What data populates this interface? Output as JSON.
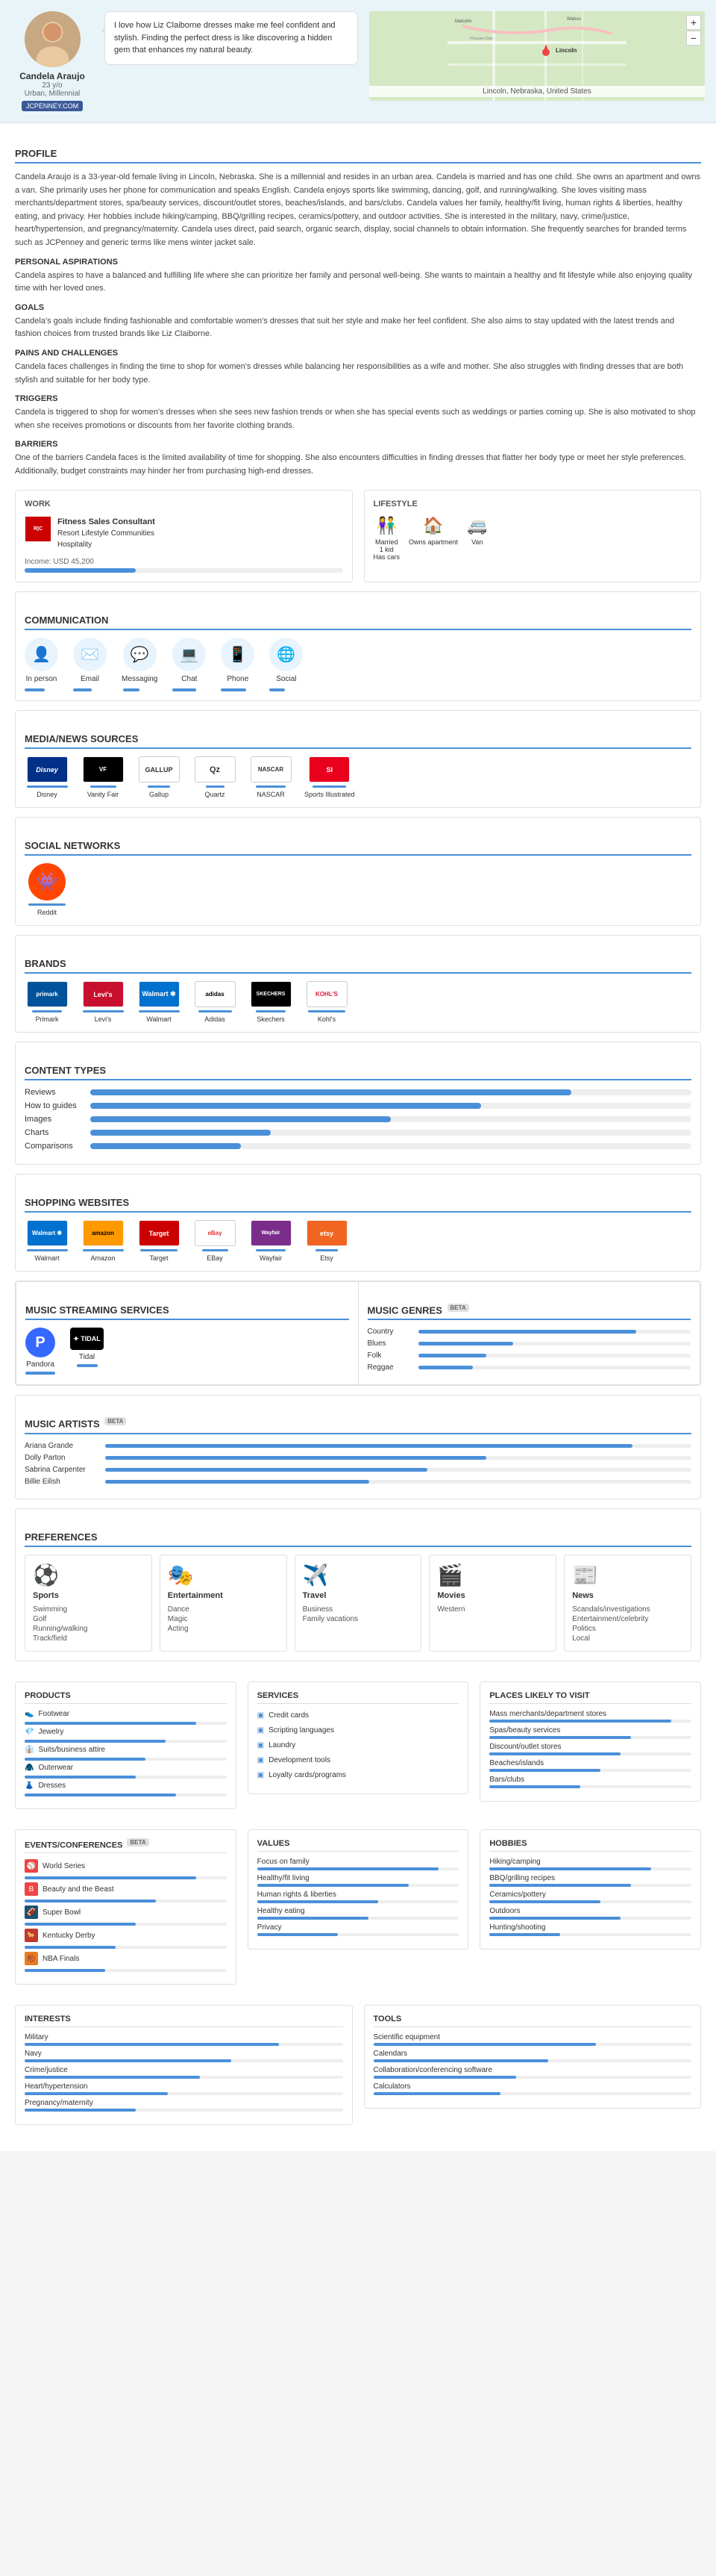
{
  "profile": {
    "name": "Candela Araujo",
    "age": "23 y/o",
    "segment": "Urban, Millennial",
    "link": "JCPENNEY.COM",
    "quote": "I love how Liz Claiborne dresses make me feel confident and stylish. Finding the perfect dress is like discovering a hidden gem that enhances my natural beauty.",
    "location": "Lincoln, Nebraska, United States",
    "bio": "Candela Araujo is a 33-year-old female living in Lincoln, Nebraska. She is a millennial and resides in an urban area. Candela is married and has one child. She owns an apartment and owns a van. She primarily uses her phone for communication and speaks English. Candela enjoys sports like swimming, dancing, golf, and running/walking. She loves visiting mass merchants/department stores, spa/beauty services, discount/outlet stores, beaches/islands, and bars/clubs. Candela values her family, healthy/fit living, human rights & liberties, healthy eating, and privacy. Her hobbies include hiking/camping, BBQ/grilling recipes, ceramics/pottery, and outdoor activities. She is interested in the military, navy, crime/justice, heart/hypertension, and pregnancy/maternity. Candela uses direct, paid search, organic search, display, social channels to obtain information. She frequently searches for branded terms such as JCPenney and generic terms like mens winter jacket sale.",
    "personal_aspirations": "Candela aspires to have a balanced and fulfilling life where she can prioritize her family and personal well-being. She wants to maintain a healthy and fit lifestyle while also enjoying quality time with her loved ones.",
    "goals": "Candela's goals include finding fashionable and comfortable women's dresses that suit her style and make her feel confident. She also aims to stay updated with the latest trends and fashion choices from trusted brands like Liz Claiborne.",
    "pains": "Candela faces challenges in finding the time to shop for women's dresses while balancing her responsibilities as a wife and mother. She also struggles with finding dresses that are both stylish and suitable for her body type.",
    "triggers": "Candela is triggered to shop for women's dresses when she sees new fashion trends or when she has special events such as weddings or parties coming up. She is also motivated to shop when she receives promotions or discounts from her favorite clothing brands.",
    "barriers": "One of the barriers Candela faces is the limited availability of time for shopping. She also encounters difficulties in finding dresses that flatter her body type or meet her style preferences. Additionally, budget constraints may hinder her from purchasing high-end dresses."
  },
  "work": {
    "title": "WORK",
    "company1": "Fitness Sales Consultant",
    "company2": "Resort Lifestyle Communities",
    "industry": "Hospitality",
    "income_label": "Income: USD 45,200",
    "income_pct": 35
  },
  "lifestyle": {
    "title": "LIFESTYLE",
    "items": [
      {
        "label": "Married\n1 kid\nHas cars",
        "icon": "👫"
      },
      {
        "label": "Owns apartment",
        "icon": "🏠"
      },
      {
        "label": "Van",
        "icon": "🚐"
      }
    ]
  },
  "communication": {
    "title": "COMMUNICATION",
    "items": [
      {
        "label": "In person",
        "icon": "👤",
        "color": "#4a90d9",
        "bar_pct": 60
      },
      {
        "label": "Email",
        "icon": "✉️",
        "color": "#4a90d9",
        "bar_pct": 55
      },
      {
        "label": "Messaging",
        "icon": "💬",
        "color": "#4a90d9",
        "bar_pct": 50
      },
      {
        "label": "Chat",
        "icon": "💻",
        "color": "#4a90d9",
        "bar_pct": 70
      },
      {
        "label": "Phone",
        "icon": "📱",
        "color": "#4a90d9",
        "bar_pct": 75
      },
      {
        "label": "Social",
        "icon": "🌐",
        "color": "#4a90d9",
        "bar_pct": 45
      }
    ]
  },
  "media_news": {
    "title": "MEDIA/NEWS SOURCES",
    "items": [
      {
        "label": "Disney",
        "logo_text": "Disney",
        "class": "disney-logo",
        "bar_pct": 70
      },
      {
        "label": "Vanity Fair",
        "logo_text": "VF",
        "class": "vf-logo",
        "bar_pct": 45
      },
      {
        "label": "Gallup",
        "logo_text": "GALLUP",
        "class": "gallup-logo",
        "bar_pct": 40
      },
      {
        "label": "Quartz",
        "logo_text": "Qz",
        "class": "quartz-logo",
        "bar_pct": 35
      },
      {
        "label": "NASCAR",
        "logo_text": "NASCAR",
        "class": "nascar-logo",
        "bar_pct": 50
      },
      {
        "label": "Sports Illustrated",
        "logo_text": "SI",
        "class": "si-logo",
        "bar_pct": 55
      }
    ]
  },
  "social_networks": {
    "title": "SOCIAL NETWORKS",
    "items": [
      {
        "label": "Reddit",
        "logo_text": "👾",
        "class": "reddit-logo",
        "bar_pct": 65
      }
    ]
  },
  "brands": {
    "title": "BRANDS",
    "items": [
      {
        "label": "Primark",
        "logo_text": "primark",
        "class": "primark-logo",
        "bar_pct": 50
      },
      {
        "label": "Levi's",
        "logo_text": "Levi's",
        "class": "levis-logo",
        "bar_pct": 75
      },
      {
        "label": "Walmart",
        "logo_text": "Walmart",
        "class": "walmart-logo",
        "bar_pct": 80
      },
      {
        "label": "Adidas",
        "logo_text": "adidas",
        "class": "adidas-logo",
        "bar_pct": 60
      },
      {
        "label": "Skechers",
        "logo_text": "SKECHERS",
        "class": "skechers-logo",
        "bar_pct": 55
      },
      {
        "label": "Kohl's",
        "logo_text": "KOHL'S",
        "class": "kohls-logo",
        "bar_pct": 65
      }
    ]
  },
  "content_types": {
    "title": "CONTENT TYPES",
    "items": [
      {
        "label": "Reviews",
        "pct": 80
      },
      {
        "label": "How to guides",
        "pct": 65
      },
      {
        "label": "Images",
        "pct": 50
      },
      {
        "label": "Charts",
        "pct": 30
      },
      {
        "label": "Comparisons",
        "pct": 25
      }
    ]
  },
  "shopping_websites": {
    "title": "SHOPPING WEBSITES",
    "items": [
      {
        "label": "Walmart",
        "logo_text": "Walmart",
        "class": "walmart-shop",
        "bar_pct": 85
      },
      {
        "label": "Amazon",
        "logo_text": "amazon",
        "class": "amazon-logo",
        "bar_pct": 90
      },
      {
        "label": "Target",
        "logo_text": "Target",
        "class": "target-logo",
        "bar_pct": 70
      },
      {
        "label": "EBay",
        "logo_text": "eBay",
        "class": "ebay-logo",
        "bar_pct": 45
      },
      {
        "label": "Wayfair",
        "logo_text": "Wayfair",
        "class": "wayfair-logo",
        "bar_pct": 55
      },
      {
        "label": "Etsy",
        "logo_text": "etsy",
        "class": "etsy-logo",
        "bar_pct": 40
      }
    ]
  },
  "music_streaming": {
    "title": "MUSIC STREAMING SERVICES",
    "items": [
      {
        "label": "Pandora",
        "icon": "P",
        "class": "pandora-logo",
        "bar_pct": 75
      },
      {
        "label": "Tidal",
        "icon": "TIDAL",
        "class": "tidal-logo",
        "bar_pct": 40
      }
    ]
  },
  "music_genres": {
    "title": "MUSIC GENRES",
    "badge": "BETA",
    "items": [
      {
        "label": "Country",
        "pct": 80
      },
      {
        "label": "Blues",
        "pct": 35
      },
      {
        "label": "Folk",
        "pct": 25
      },
      {
        "label": "Reggae",
        "pct": 20
      }
    ]
  },
  "music_artists": {
    "title": "MUSIC ARTISTS",
    "badge": "BETA",
    "items": [
      {
        "label": "Ariana Grande",
        "pct": 90
      },
      {
        "label": "Dolly Parton",
        "pct": 65
      },
      {
        "label": "Sabrina Carpenter",
        "pct": 55
      },
      {
        "label": "Billie Eilish",
        "pct": 45
      }
    ]
  },
  "preferences": {
    "title": "PREFERENCES",
    "categories": [
      {
        "icon": "⚽",
        "title": "Sports",
        "items": [
          "Swimming",
          "Golf",
          "Running/walking",
          "Track/field"
        ]
      },
      {
        "icon": "🎭",
        "title": "Entertainment",
        "items": [
          "Dance",
          "Magic",
          "Acting"
        ]
      },
      {
        "icon": "✈️",
        "title": "Travel",
        "items": [
          "Business",
          "Family vacations"
        ]
      },
      {
        "icon": "🎬",
        "title": "Movies",
        "items": [
          "Western"
        ]
      },
      {
        "icon": "📰",
        "title": "News",
        "items": [
          "Scandals/investigations",
          "Entertainment/celebrity",
          "Politics",
          "Local"
        ]
      }
    ]
  },
  "products": {
    "title": "PRODUCTS",
    "items": [
      {
        "label": "Footwear",
        "bar_pct": 85,
        "color": "#4a90d9"
      },
      {
        "label": "Jewelry",
        "bar_pct": 70,
        "color": "#4a90d9"
      },
      {
        "label": "Suits/business attire",
        "bar_pct": 60,
        "color": "#4a90d9"
      },
      {
        "label": "Outerwear",
        "bar_pct": 55,
        "color": "#4a90d9"
      },
      {
        "label": "Dresses",
        "bar_pct": 75,
        "color": "#4a90d9"
      }
    ]
  },
  "services": {
    "title": "SERVICES",
    "items": [
      {
        "label": "Credit cards"
      },
      {
        "label": "Scripting languages"
      },
      {
        "label": "Laundry"
      },
      {
        "label": "Development tools"
      },
      {
        "label": "Loyalty cards/programs"
      }
    ]
  },
  "places": {
    "title": "PLACES LIKELY TO VISIT",
    "items": [
      {
        "label": "Mass merchants/department stores",
        "bar_pct": 90,
        "color": "#4a90d9"
      },
      {
        "label": "Spas/beauty services",
        "bar_pct": 70,
        "color": "#4a90d9"
      },
      {
        "label": "Discount/outlet stores",
        "bar_pct": 65,
        "color": "#4a90d9"
      },
      {
        "label": "Beaches/islands",
        "bar_pct": 55,
        "color": "#4a90d9"
      },
      {
        "label": "Bars/clubs",
        "bar_pct": 45,
        "color": "#4a90d9"
      }
    ]
  },
  "events": {
    "title": "EVENTS/CONFERENCES",
    "badge": "BETA",
    "items": [
      {
        "label": "World Series",
        "bar_pct": 85,
        "icon": "⚾",
        "icon_color": "#cc0000"
      },
      {
        "label": "Beauty and the Beast",
        "bar_pct": 65,
        "icon": "B",
        "icon_color": "#e44"
      },
      {
        "label": "Super Bowl",
        "bar_pct": 55,
        "icon": "🏈",
        "icon_color": "#1a5276"
      },
      {
        "label": "Kentucky Derby",
        "bar_pct": 45,
        "icon": "🐎",
        "icon_color": "#c0392b"
      },
      {
        "label": "NBA Finals",
        "bar_pct": 40,
        "icon": "🏀",
        "icon_color": "#e67e22"
      }
    ]
  },
  "values": {
    "title": "VALUES",
    "items": [
      {
        "label": "Focus on family",
        "bar_pct": 90
      },
      {
        "label": "Healthy/fit living",
        "bar_pct": 75
      },
      {
        "label": "Human rights & liberties",
        "bar_pct": 60
      },
      {
        "label": "Healthy eating",
        "bar_pct": 55
      },
      {
        "label": "Privacy",
        "bar_pct": 40
      }
    ]
  },
  "hobbies": {
    "title": "HOBBIES",
    "items": [
      {
        "label": "Hiking/camping",
        "bar_pct": 80
      },
      {
        "label": "BBQ/grilling recipes",
        "bar_pct": 70
      },
      {
        "label": "Ceramics/pottery",
        "bar_pct": 55
      },
      {
        "label": "Outdoors",
        "bar_pct": 65
      },
      {
        "label": "Hunting/shooting",
        "bar_pct": 35
      }
    ]
  },
  "interests": {
    "title": "INTERESTS",
    "items": [
      {
        "label": "Military",
        "bar_pct": 80
      },
      {
        "label": "Navy",
        "bar_pct": 65
      },
      {
        "label": "Crime/justice",
        "bar_pct": 55
      },
      {
        "label": "Heart/hypertension",
        "bar_pct": 45
      },
      {
        "label": "Pregnancy/maternity",
        "bar_pct": 35
      }
    ]
  },
  "tools": {
    "title": "TOOLS",
    "items": [
      {
        "label": "Scientific equipment",
        "bar_pct": 70
      },
      {
        "label": "Calendars",
        "bar_pct": 55
      },
      {
        "label": "Collaboration/conferencing software",
        "bar_pct": 45
      },
      {
        "label": "Calculators",
        "bar_pct": 40
      }
    ]
  }
}
